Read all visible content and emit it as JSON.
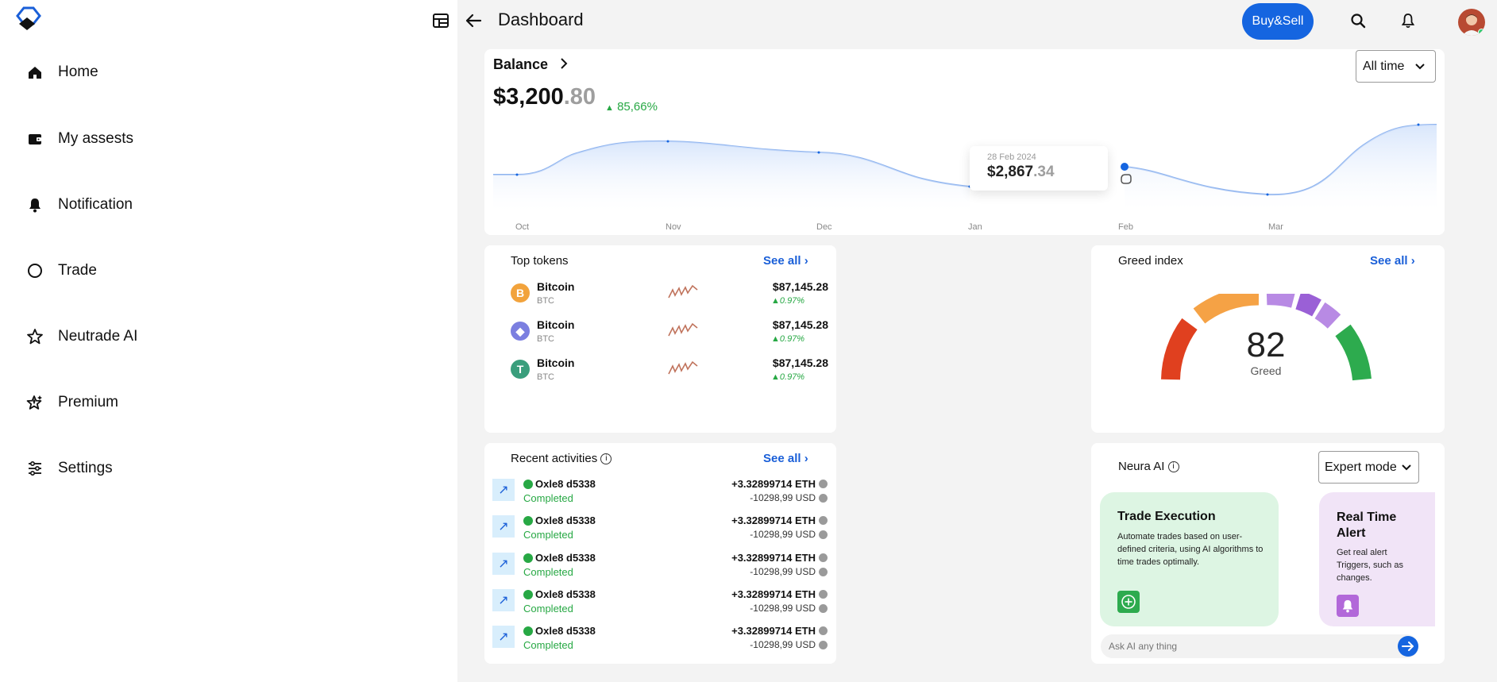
{
  "sidebar": {
    "items": [
      {
        "label": "Home",
        "icon": "home-icon"
      },
      {
        "label": "My assests",
        "icon": "wallet-icon"
      },
      {
        "label": "Notification",
        "icon": "bell-icon"
      },
      {
        "label": "Trade",
        "icon": "circle-icon"
      },
      {
        "label": "Neutrade AI",
        "icon": "star-icon"
      },
      {
        "label": "Premium",
        "icon": "star-sparkle-icon"
      },
      {
        "label": "Settings",
        "icon": "sliders-icon"
      }
    ]
  },
  "header": {
    "title": "Dashboard",
    "buy_sell_label": "Buy&Sell"
  },
  "balance": {
    "label": "Balance",
    "amount_int": "$3,200",
    "amount_dec": ".80",
    "change": "85,66%",
    "range_select": "All time",
    "tooltip": {
      "date": "28 Feb 2024",
      "value_int": "$2,867",
      "value_dec": ".34"
    },
    "months": [
      "Oct",
      "Nov",
      "Dec",
      "Jan",
      "Feb",
      "Mar"
    ]
  },
  "chart_data": {
    "type": "area",
    "x": [
      "Oct",
      "Nov",
      "Dec",
      "Jan",
      "Feb",
      "Mar"
    ],
    "series": [
      {
        "values": [
          2650,
          3050,
          2950,
          2480,
          2867,
          2200,
          3200
        ]
      }
    ]
  },
  "top_tokens": {
    "title": "Top tokens",
    "see_all": "See all",
    "items": [
      {
        "name": "Bitcoin",
        "symbol": "BTC",
        "price": "$87,145.28",
        "change": "0.97%",
        "logo_color": "#f2a33c",
        "logo_char": "B"
      },
      {
        "name": "Bitcoin",
        "symbol": "BTC",
        "price": "$87,145.28",
        "change": "0.97%",
        "logo_color": "#7b7fe0",
        "logo_char": "◆"
      },
      {
        "name": "Bitcoin",
        "symbol": "BTC",
        "price": "$87,145.28",
        "change": "0.97%",
        "logo_color": "#3a9e7c",
        "logo_char": "T"
      }
    ]
  },
  "greed": {
    "title": "Greed index",
    "see_all": "See all",
    "value": "82",
    "label": "Greed"
  },
  "activities": {
    "title": "Recent activities",
    "see_all": "See all",
    "items": [
      {
        "name": "Oxle8 d5338",
        "status": "Completed",
        "amount": "+3.32899714 ETH",
        "usd": "-10298,99 USD"
      },
      {
        "name": "Oxle8 d5338",
        "status": "Completed",
        "amount": "+3.32899714 ETH",
        "usd": "-10298,99 USD"
      },
      {
        "name": "Oxle8 d5338",
        "status": "Completed",
        "amount": "+3.32899714 ETH",
        "usd": "-10298,99 USD"
      },
      {
        "name": "Oxle8 d5338",
        "status": "Completed",
        "amount": "+3.32899714 ETH",
        "usd": "-10298,99 USD"
      },
      {
        "name": "Oxle8 d5338",
        "status": "Completed",
        "amount": "+3.32899714 ETH",
        "usd": "-10298,99 USD"
      }
    ]
  },
  "neura": {
    "title": "Neura AI",
    "mode_select": "Expert mode",
    "cards": [
      {
        "title": "Trade Execution",
        "desc": "Automate trades based on user-defined criteria, using AI algorithms to time trades optimally."
      },
      {
        "title": "Real Time Alert",
        "desc": "Get real alert Triggers, such as changes."
      }
    ],
    "ask_placeholder": "Ask AI any thing"
  },
  "colors": {
    "accent": "#1565e0",
    "positive": "#27a844",
    "link": "#1a5fd8"
  }
}
